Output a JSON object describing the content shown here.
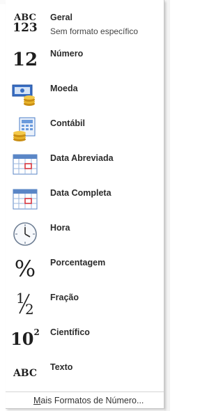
{
  "menu": {
    "items": [
      {
        "label": "Geral",
        "sub": "Sem formato específico",
        "icon": "abc-123-icon"
      },
      {
        "label": "Número",
        "icon": "number-12-icon"
      },
      {
        "label": "Moeda",
        "icon": "currency-icon"
      },
      {
        "label": "Contábil",
        "icon": "accounting-icon"
      },
      {
        "label": "Data Abreviada",
        "icon": "short-date-calendar-icon"
      },
      {
        "label": "Data Completa",
        "icon": "long-date-calendar-icon"
      },
      {
        "label": "Hora",
        "icon": "clock-icon"
      },
      {
        "label": "Porcentagem",
        "icon": "percent-icon"
      },
      {
        "label": "Fração",
        "icon": "fraction-icon"
      },
      {
        "label": "Científico",
        "icon": "scientific-icon"
      },
      {
        "label": "Texto",
        "icon": "text-abc-icon"
      }
    ],
    "icon_text": {
      "abc": "ABC",
      "n123": "123",
      "n12": "12",
      "percent": "%",
      "frac_num": "1",
      "frac_den": "2",
      "sci_base": "10",
      "sci_exp": "2",
      "text_abc": "ABC"
    },
    "more_label": "Mais Formatos de Número..."
  }
}
